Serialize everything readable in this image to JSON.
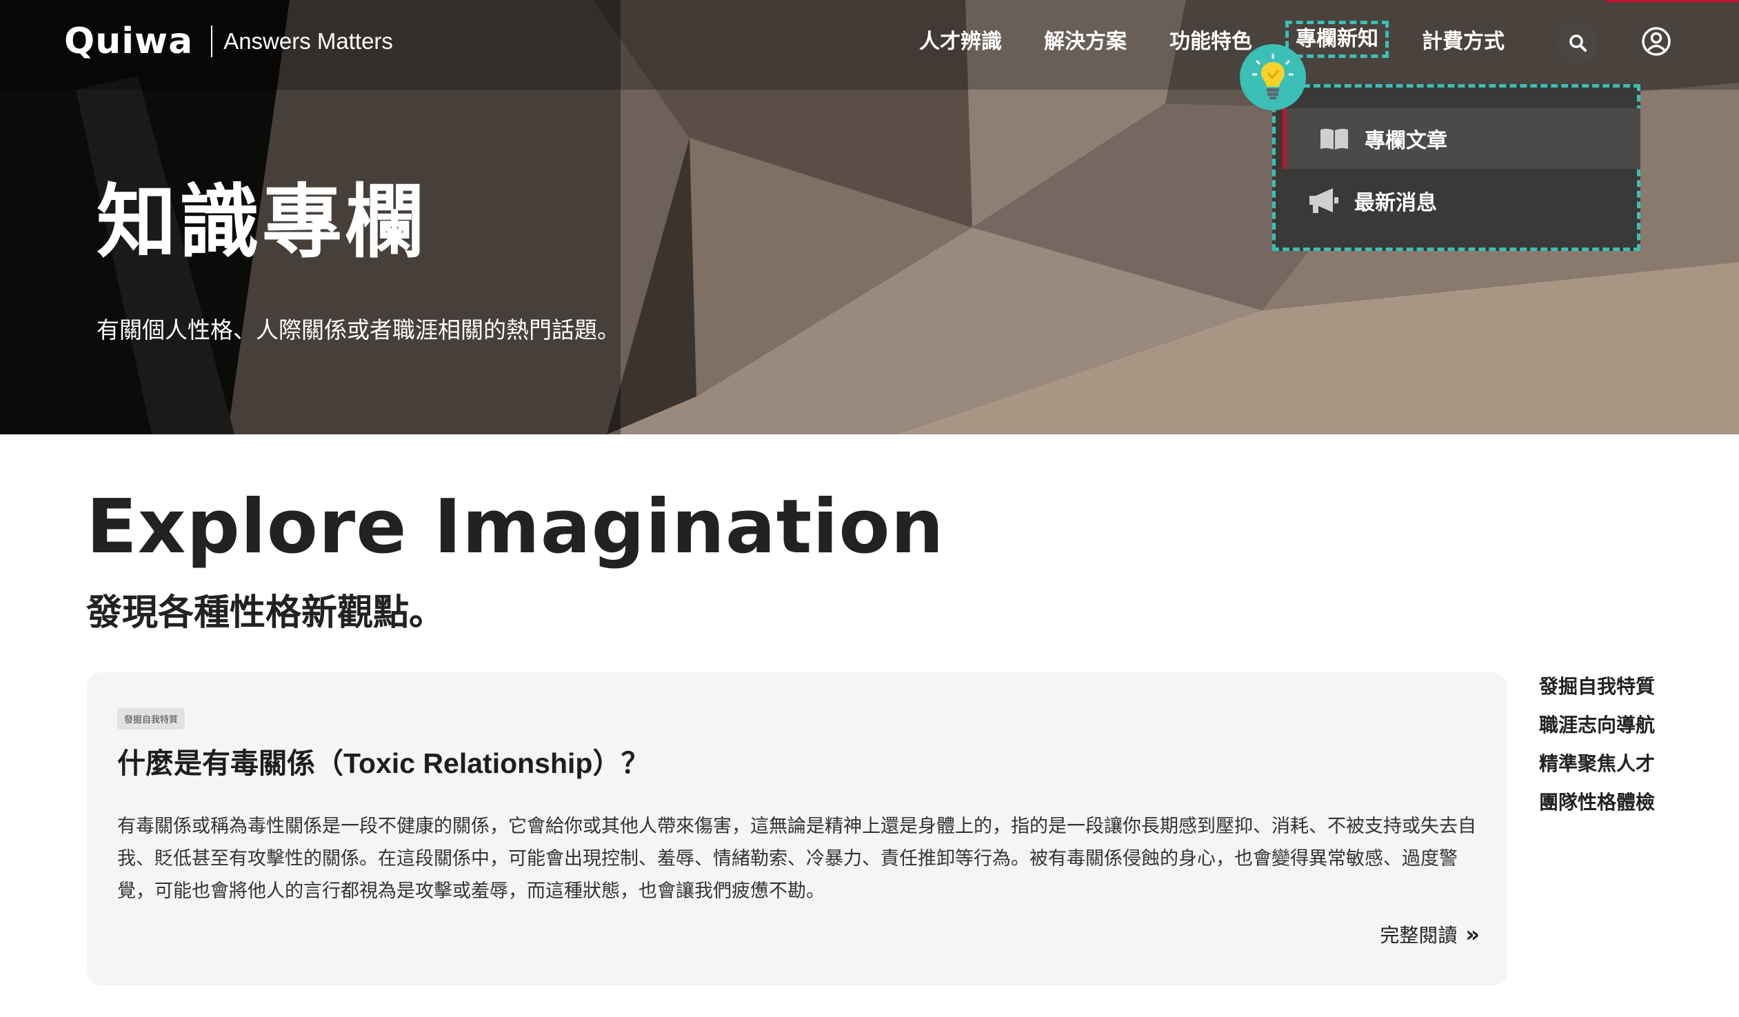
{
  "header": {
    "logo": "Quiwa",
    "tagline": "Answers Matters",
    "nav": [
      {
        "label": "人才辨識"
      },
      {
        "label": "解決方案"
      },
      {
        "label": "功能特色"
      },
      {
        "label": "專欄新知"
      },
      {
        "label": "計費方式"
      }
    ],
    "icons": {
      "search": "search-icon",
      "account": "user-circle-icon",
      "lightbulb": "lightbulb-icon"
    }
  },
  "dropdown": {
    "items": [
      {
        "label": "專欄文章",
        "icon": "book-icon"
      },
      {
        "label": "最新消息",
        "icon": "megaphone-icon"
      }
    ]
  },
  "hero": {
    "title": "知識專欄",
    "subtitle": "有關個人性格、人際關係或者職涯相關的熱門話題。"
  },
  "main": {
    "heading": "Explore Imagination",
    "subheading": "發現各種性格新觀點。"
  },
  "article": {
    "category": "發掘自我特質",
    "title": "什麼是有毒關係（Toxic Relationship）？",
    "body": "有毒關係或稱為毒性關係是一段不健康的關係，它會給你或其他人帶來傷害，這無論是精神上還是身體上的，指的是一段讓你長期感到壓抑、消耗、不被支持或失去自我、貶低甚至有攻擊性的關係。在這段關係中，可能會出現控制、羞辱、情緒勒索、冷暴力、責任推卸等行為。被有毒關係侵蝕的身心，也會變得異常敏感、過度警覺，可能也會將他人的言行都視為是攻擊或羞辱，而這種狀態，也會讓我們疲憊不勘。",
    "read_more": "完整閱讀"
  },
  "sidebar": {
    "categories": [
      {
        "label": "發掘自我特質"
      },
      {
        "label": "職涯志向導航"
      },
      {
        "label": "精準聚焦人才"
      },
      {
        "label": "團隊性格體檢"
      }
    ]
  },
  "colors": {
    "accent_teal": "#3bbfb7",
    "accent_red": "#c8102e",
    "dropdown_bg": "#3a3937",
    "card_bg": "#f5f5f5"
  }
}
